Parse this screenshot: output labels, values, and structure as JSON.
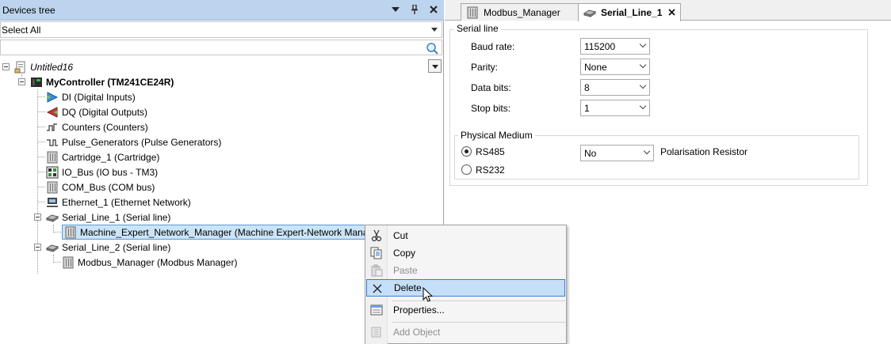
{
  "devices_tree": {
    "title": "Devices tree",
    "filter_value": "Select All",
    "search_placeholder": "",
    "nodes": [
      {
        "label": "Untitled16",
        "icon": "project-icon"
      },
      {
        "label": "MyController (TM241CE24R)",
        "icon": "controller-icon"
      },
      {
        "label": "DI (Digital Inputs)",
        "icon": "digital-inputs-icon"
      },
      {
        "label": "DQ (Digital Outputs)",
        "icon": "digital-outputs-icon"
      },
      {
        "label": "Counters (Counters)",
        "icon": "counters-icon"
      },
      {
        "label": "Pulse_Generators (Pulse Generators)",
        "icon": "pulse-generator-icon"
      },
      {
        "label": "Cartridge_1 (Cartridge)",
        "icon": "cartridge-icon"
      },
      {
        "label": "IO_Bus (IO bus - TM3)",
        "icon": "io-bus-icon"
      },
      {
        "label": "COM_Bus (COM bus)",
        "icon": "com-bus-icon"
      },
      {
        "label": "Ethernet_1 (Ethernet Network)",
        "icon": "ethernet-icon"
      },
      {
        "label": "Serial_Line_1 (Serial line)",
        "icon": "serial-line-icon"
      },
      {
        "label": "Machine_Expert_Network_Manager (Machine Expert-Network Manager)",
        "icon": "network-manager-icon"
      },
      {
        "label": "Serial_Line_2 (Serial line)",
        "icon": "serial-line-icon"
      },
      {
        "label": "Modbus_Manager (Modbus Manager)",
        "icon": "modbus-manager-icon"
      }
    ]
  },
  "tabs": [
    {
      "label": "Modbus_Manager",
      "active": false
    },
    {
      "label": "Serial_Line_1",
      "active": true
    }
  ],
  "serial_line": {
    "title": "Serial line",
    "baud_rate_label": "Baud rate:",
    "baud_rate_value": "115200",
    "parity_label": "Parity:",
    "parity_value": "None",
    "data_bits_label": "Data bits:",
    "data_bits_value": "8",
    "stop_bits_label": "Stop bits:",
    "stop_bits_value": "1"
  },
  "physical_medium": {
    "title": "Physical Medium",
    "rs485_label": "RS485",
    "rs485_checked": true,
    "rs232_label": "RS232",
    "rs232_checked": false,
    "polarisation_value": "No",
    "polarisation_label": "Polarisation Resistor"
  },
  "context_menu": {
    "items": [
      {
        "label": "Cut",
        "icon": "scissors-icon",
        "enabled": true
      },
      {
        "label": "Copy",
        "icon": "copy-icon",
        "enabled": true
      },
      {
        "label": "Paste",
        "icon": "paste-icon",
        "enabled": false
      },
      {
        "label": "Delete",
        "icon": "delete-icon",
        "enabled": true,
        "highlighted": true
      },
      {
        "label": "Properties...",
        "icon": "properties-icon",
        "enabled": true
      },
      {
        "label": "Add Object",
        "icon": "add-object-icon",
        "enabled": false
      }
    ]
  },
  "colors": {
    "header_bg": "#bcd4ee",
    "selection_bg": "#cce4f7",
    "menu_highlight": "#c5dff8"
  }
}
